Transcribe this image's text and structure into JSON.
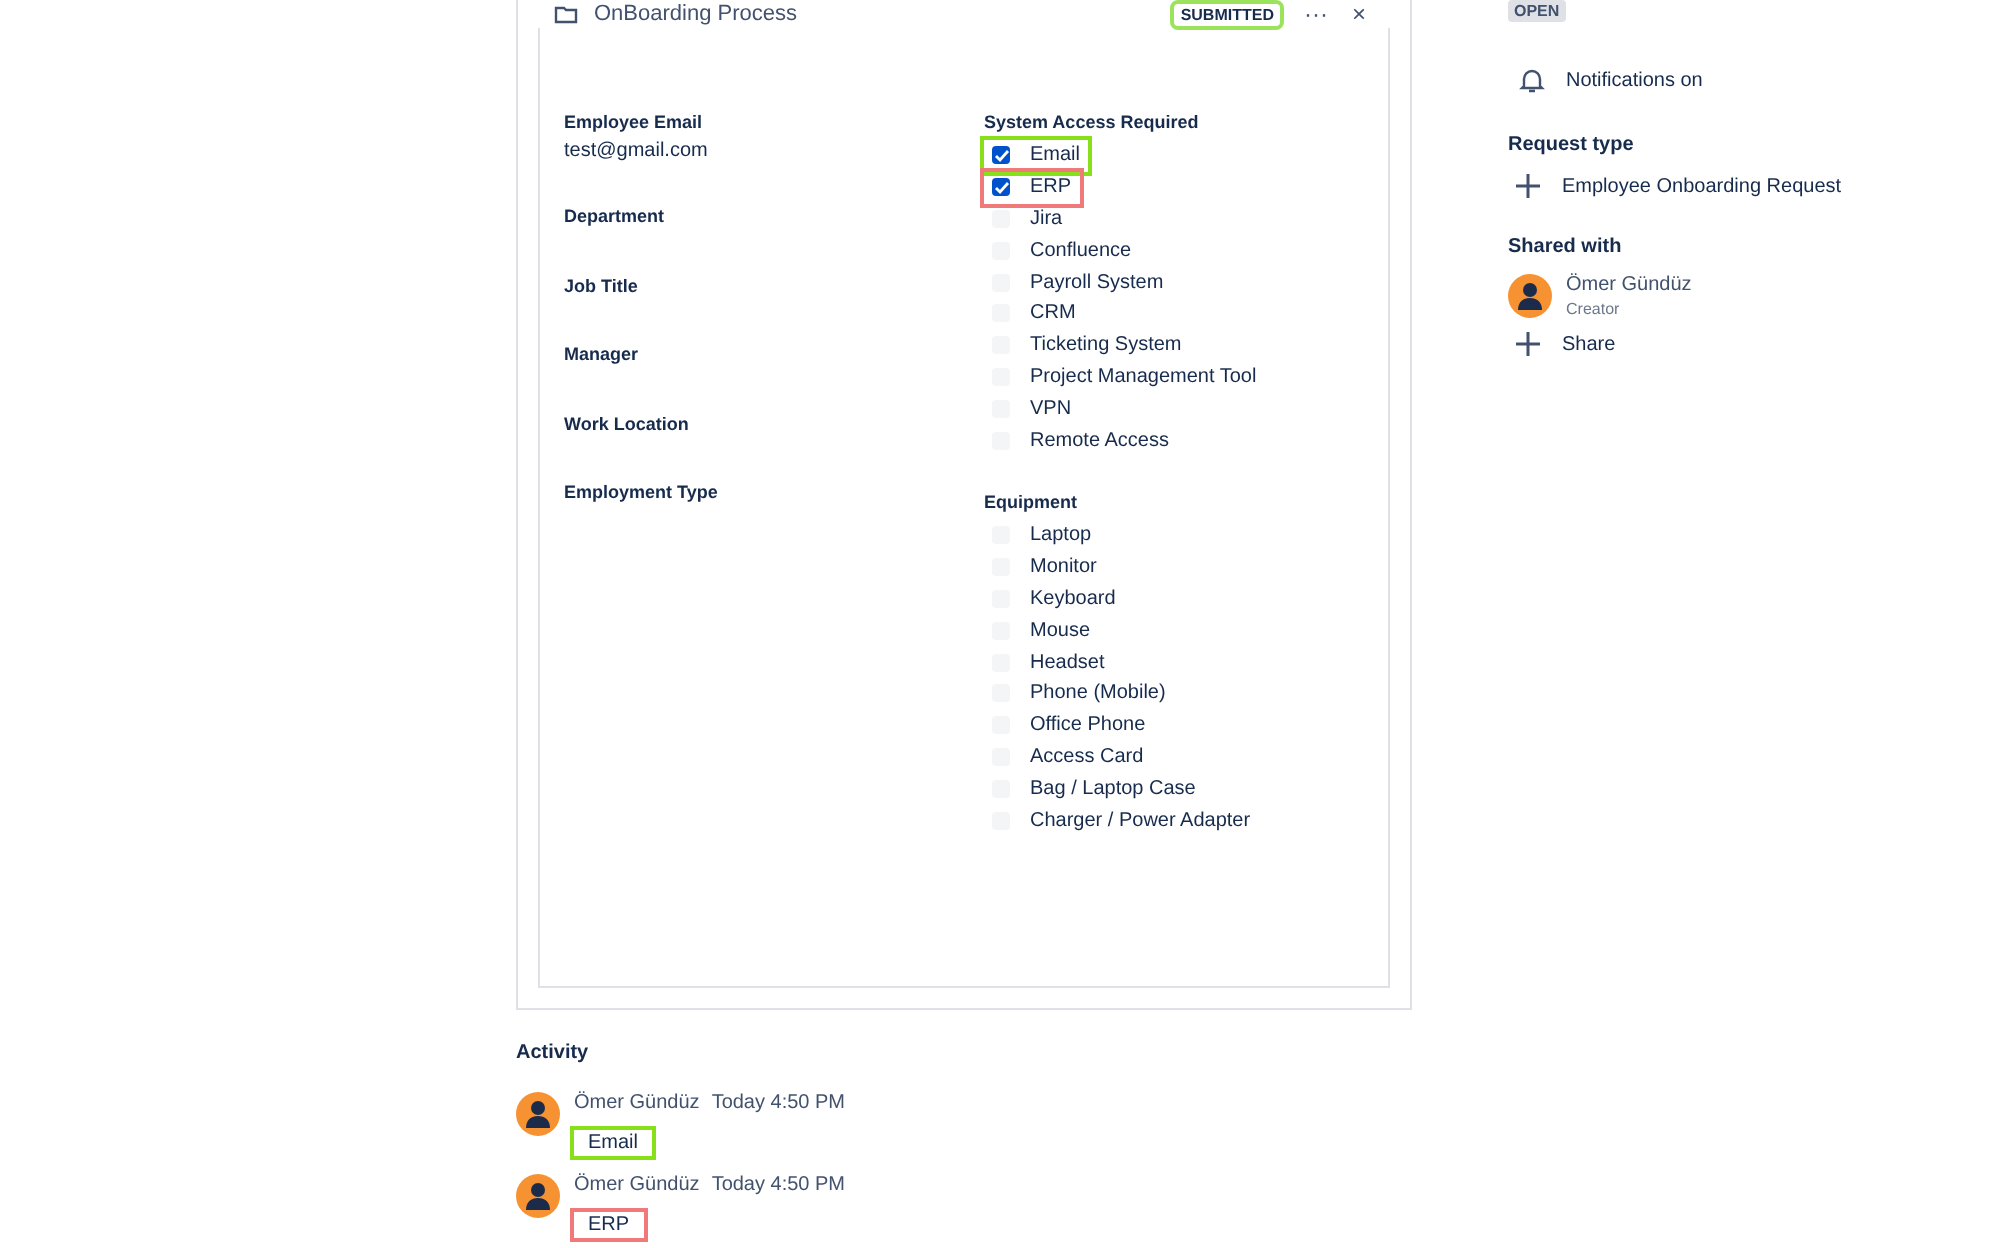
{
  "request": {
    "title": "OnBoarding Process",
    "status_badge": {
      "label": "SUBMITTED",
      "color": "#9be35a"
    },
    "more": "···",
    "close": "×"
  },
  "fields": [
    {
      "label": "Employee Email",
      "value": "test@gmail.com"
    },
    {
      "label": "Department"
    },
    {
      "label": "Job Title"
    },
    {
      "label": "Manager"
    },
    {
      "label": "Work Location"
    },
    {
      "label": "Employment Type"
    }
  ],
  "groups": [
    {
      "label": "System Access Required",
      "options": [
        {
          "label": "Email",
          "checked": true,
          "color": "#88e01a"
        },
        {
          "label": "ERP",
          "checked": true,
          "color": "#f07a7a"
        },
        {
          "label": "Jira",
          "checked": false
        },
        {
          "label": "Confluence",
          "checked": false
        },
        {
          "label": "Payroll System",
          "checked": false
        },
        {
          "label": "CRM",
          "checked": false
        },
        {
          "label": "Ticketing System",
          "checked": false
        },
        {
          "label": "Project Management Tool",
          "checked": false
        },
        {
          "label": "VPN",
          "checked": false
        },
        {
          "label": "Remote Access",
          "checked": false
        }
      ]
    },
    {
      "label": "Equipment",
      "options": [
        {
          "label": "Laptop",
          "checked": false
        },
        {
          "label": "Monitor",
          "checked": false
        },
        {
          "label": "Keyboard",
          "checked": false
        },
        {
          "label": "Mouse",
          "checked": false
        },
        {
          "label": "Headset",
          "checked": false
        },
        {
          "label": "Phone (Mobile)",
          "checked": false
        },
        {
          "label": "Office Phone",
          "checked": false
        },
        {
          "label": "Access Card",
          "checked": false
        },
        {
          "label": "Bag / Laptop Case",
          "checked": false
        },
        {
          "label": "Charger / Power Adapter",
          "checked": false
        }
      ]
    }
  ],
  "activity": {
    "heading": "Activity",
    "entries": [
      {
        "author": "Ömer Gündüz",
        "time": "Today 4:50 PM",
        "text": "Email",
        "color": "#88e01a"
      },
      {
        "author": "Ömer Gündüz",
        "time": "Today 4:50 PM",
        "text": "ERP",
        "color": "#f07a7a"
      }
    ]
  },
  "sidebar": {
    "status": "OPEN",
    "notifications": "Notifications on",
    "request_type": {
      "heading": "Request type",
      "value": "Employee Onboarding Request"
    },
    "shared_with": {
      "heading": "Shared with",
      "people": [
        {
          "name": "Ömer Gündüz",
          "role": "Creator"
        }
      ],
      "share": "Share"
    }
  }
}
